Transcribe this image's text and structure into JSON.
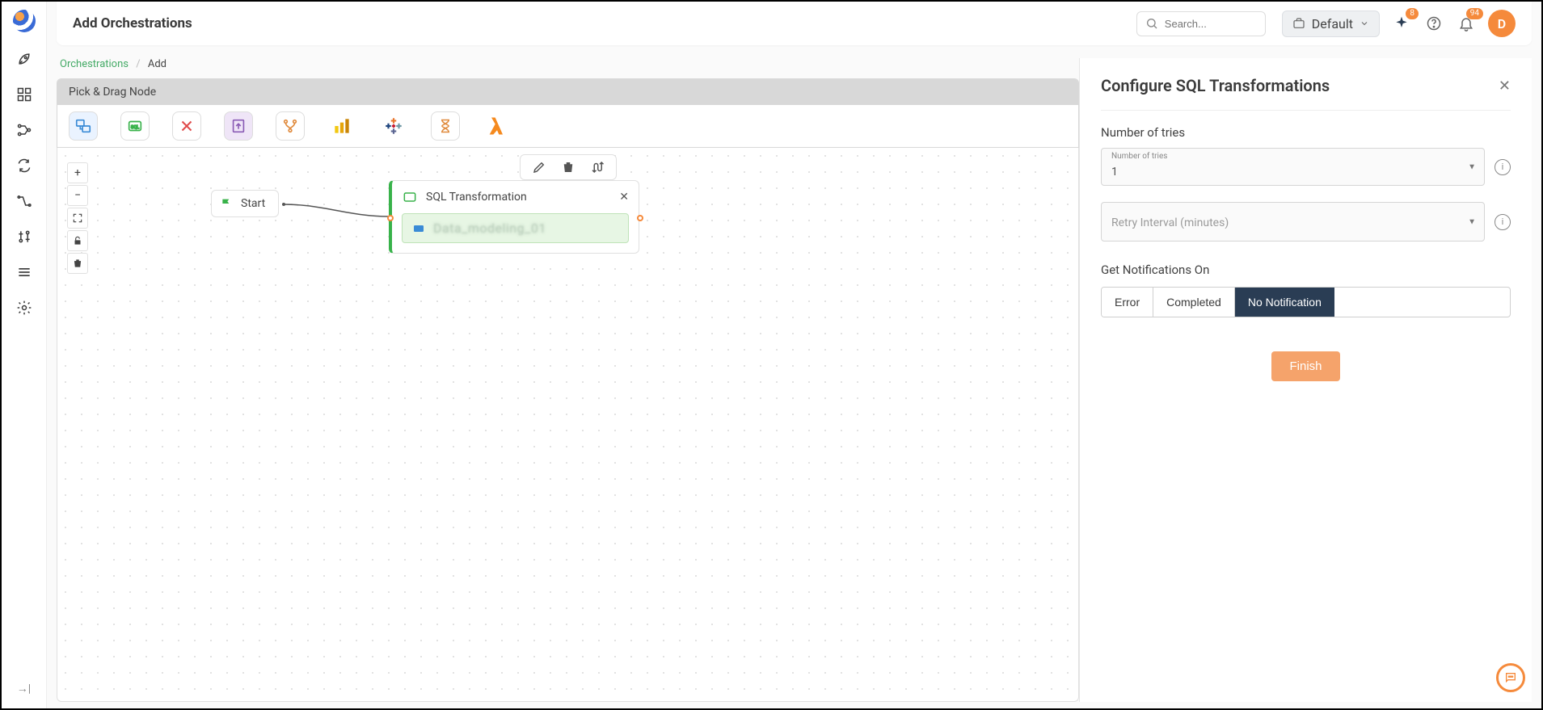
{
  "header": {
    "title": "Add Orchestrations",
    "search_placeholder": "Search...",
    "workspace_label": "Default",
    "sparkle_badge": "8",
    "bell_badge": "94",
    "avatar_initial": "D"
  },
  "breadcrumb": {
    "root": "Orchestrations",
    "current": "Add"
  },
  "palette": {
    "title": "Pick & Drag Node",
    "items": [
      "migration",
      "sql",
      "cancel",
      "upload",
      "branch",
      "powerbi",
      "tableau",
      "hourglass",
      "lambda"
    ]
  },
  "canvas": {
    "start_label": "Start",
    "sql_node_title": "SQL Transformation",
    "sql_node_sub": "Data_modeling_01"
  },
  "panel": {
    "title": "Configure SQL Transformations",
    "tries_section_label": "Number of tries",
    "tries_mini_label": "Number of tries",
    "tries_value": "1",
    "retry_placeholder": "Retry Interval (minutes)",
    "notif_label": "Get Notifications On",
    "notif_options": [
      "Error",
      "Completed",
      "No Notification"
    ],
    "notif_active_index": 2,
    "finish_label": "Finish"
  }
}
